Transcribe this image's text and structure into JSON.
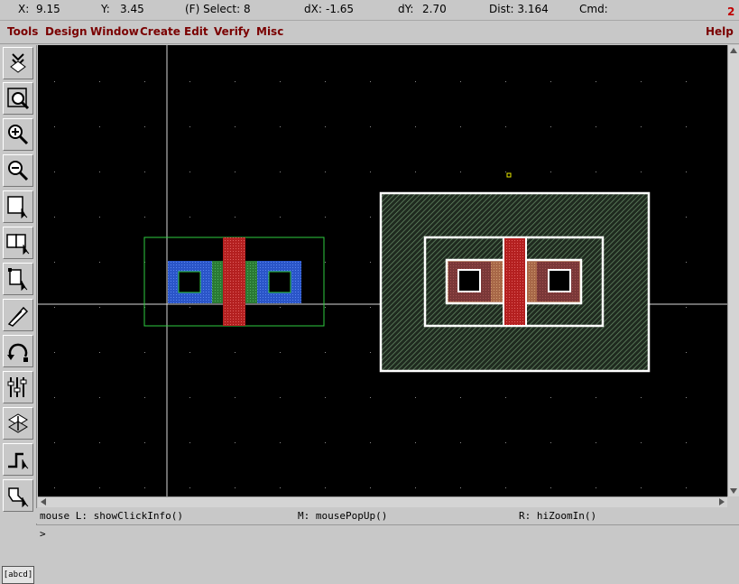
{
  "status": {
    "x_label": "X:",
    "x_value": "9.15",
    "y_label": "Y:",
    "y_value": "3.45",
    "select": "(F) Select: 8",
    "dx_label": "dX:",
    "dx_value": "-1.65",
    "dy_label": "dY:",
    "dy_value": "2.70",
    "dist": "Dist: 3.164",
    "cmd": "Cmd:",
    "window_number": "2"
  },
  "menu": {
    "items": [
      "Tools",
      "Design",
      "Window",
      "Create",
      "Edit",
      "Verify",
      "Misc"
    ],
    "help": "Help"
  },
  "toolbar": {
    "icons": [
      "save-icon",
      "fit-zoom-icon",
      "zoom-in-icon",
      "zoom-out-icon",
      "select-icon",
      "multi-select-icon",
      "partial-select-icon",
      "stretch-icon",
      "undo-icon",
      "property-icon",
      "move-icon",
      "path-icon",
      "polygon-icon"
    ],
    "label": "[abcd]"
  },
  "mouse_bindings": {
    "left": "mouse L: showClickInfo()",
    "middle": "M: mousePopUp()",
    "right": "R: hiZoomIn()"
  },
  "command": {
    "prompt": ">"
  },
  "colors": {
    "menu_text": "#7a0000",
    "canvas_bg": "#000000",
    "poly": "#c02020",
    "diffusion": "#2e8b3a",
    "metal": "#2d5fd4",
    "nwell": "#4f6e4f",
    "pdiff": "#b07a50"
  }
}
